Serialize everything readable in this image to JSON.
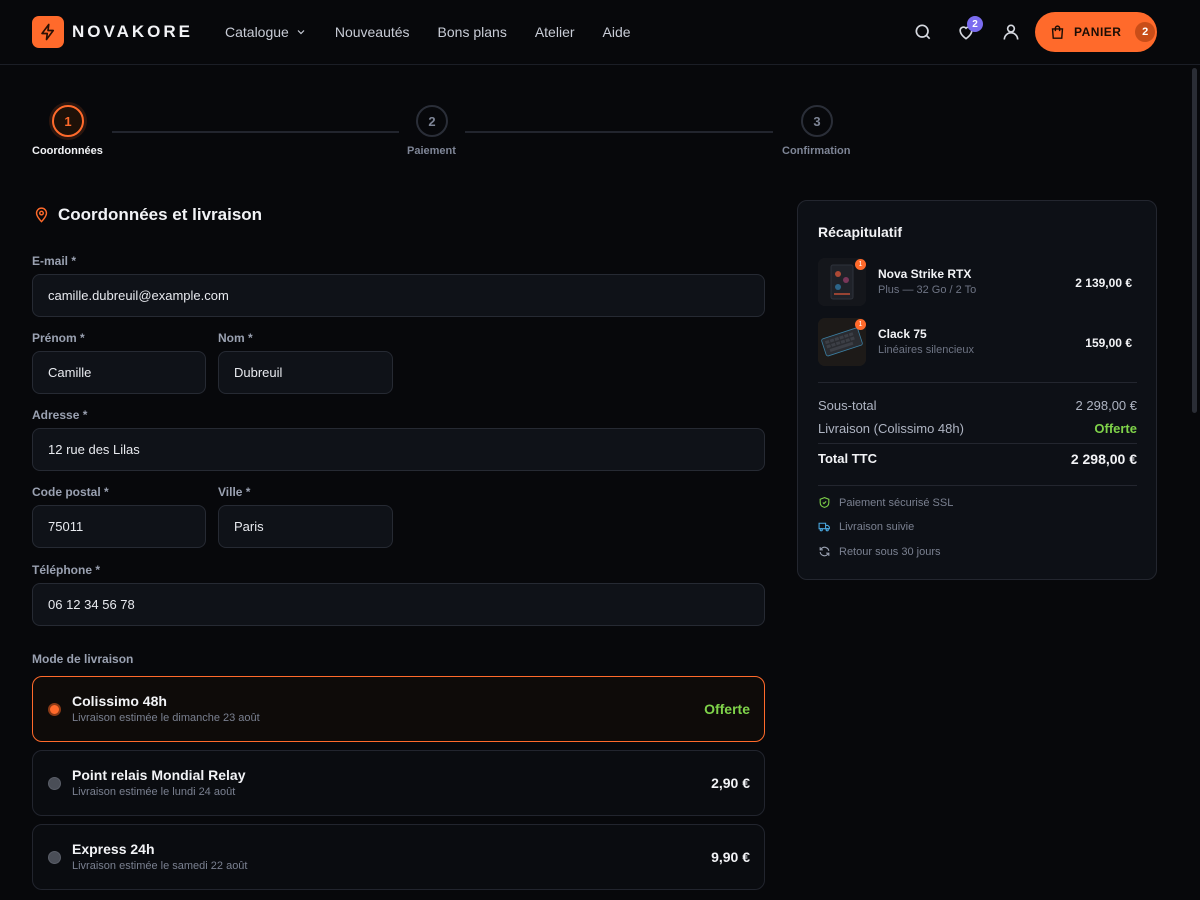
{
  "brand": {
    "name": "NOVAKORE",
    "accent": "#ff6a2b"
  },
  "nav": {
    "items": [
      {
        "label": "Catalogue",
        "dropdown": true
      },
      {
        "label": "Nouveautés"
      },
      {
        "label": "Bons plans"
      },
      {
        "label": "Atelier"
      },
      {
        "label": "Aide"
      }
    ]
  },
  "header": {
    "wishlist_count": "2",
    "cart_label": "PANIER",
    "cart_count": "2"
  },
  "stepper": {
    "steps": [
      {
        "num": "1",
        "label": "Coordonnées",
        "active": true
      },
      {
        "num": "2",
        "label": "Paiement"
      },
      {
        "num": "3",
        "label": "Confirmation"
      }
    ]
  },
  "form": {
    "title": "Coordonnées et livraison",
    "email": {
      "label": "E-mail *",
      "value": "camille.dubreuil@example.com"
    },
    "firstname": {
      "label": "Prénom *",
      "value": "Camille"
    },
    "lastname": {
      "label": "Nom *",
      "value": "Dubreuil"
    },
    "address": {
      "label": "Adresse *",
      "value": "12 rue des Lilas"
    },
    "postcode": {
      "label": "Code postal *",
      "value": "75011"
    },
    "city": {
      "label": "Ville *",
      "value": "Paris"
    },
    "phone": {
      "label": "Téléphone *",
      "value": "06 12 34 56 78"
    }
  },
  "shipping": {
    "label": "Mode de livraison",
    "options": [
      {
        "name": "Colissimo 48h",
        "sub": "Livraison estimée le dimanche 23 août",
        "price": "Offerte",
        "selected": true
      },
      {
        "name": "Point relais Mondial Relay",
        "sub": "Livraison estimée le lundi 24 août",
        "price": "2,90 €"
      },
      {
        "name": "Express 24h",
        "sub": "Livraison estimée le samedi 22 août",
        "price": "9,90 €"
      }
    ]
  },
  "summary": {
    "title": "Récapitulatif",
    "items": [
      {
        "name": "Nova Strike RTX",
        "sub": "Plus — 32 Go / 2 To",
        "price": "2 139,00 €",
        "qty": "1"
      },
      {
        "name": "Clack 75",
        "sub": "Linéaires silencieux",
        "price": "159,00 €",
        "qty": "1"
      }
    ],
    "subtotal_label": "Sous-total",
    "subtotal": "2 298,00 €",
    "shipping_label": "Livraison (Colissimo 48h)",
    "shipping_value": "Offerte",
    "total_label": "Total TTC",
    "total": "2 298,00 €",
    "trust": [
      {
        "icon": "shield-check-icon",
        "label": "Paiement sécurisé SSL"
      },
      {
        "icon": "truck-icon",
        "label": "Livraison suivie"
      },
      {
        "icon": "refresh-icon",
        "label": "Retour sous 30 jours"
      }
    ]
  },
  "colors": {
    "free": "#7fd34a",
    "badge": "#7b6cf0"
  }
}
